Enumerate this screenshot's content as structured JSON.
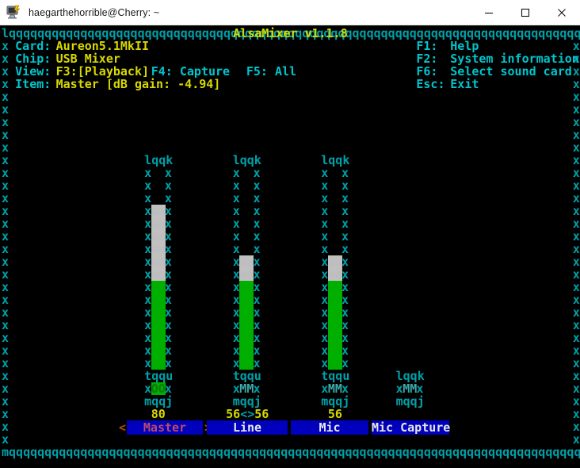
{
  "window": {
    "title": "haegarthehorrible@Cherry: ~",
    "icon": "putty-terminal-icon",
    "minimize_label": "–",
    "maximize_label": "□",
    "close_label": "✕"
  },
  "app": {
    "name": "AlsaMixer",
    "version": "v1.1.8",
    "header_title": "AlsaMixer v1.1.8"
  },
  "info": {
    "card_label": "Card:",
    "card_value": "Aureon5.1MkII",
    "chip_label": "Chip:",
    "chip_value": "USB Mixer",
    "view_label": "View:",
    "view_value": "F3:[Playback] F4: Capture  F5: All",
    "view_playback": "F3:[Playback]",
    "view_capture": "F4: Capture",
    "view_all": "F5: All",
    "item_label": "Item:",
    "item_value": "Master [dB gain: -4.94]"
  },
  "help": [
    {
      "key": "F1:",
      "text": "Help"
    },
    {
      "key": "F2:",
      "text": "System information"
    },
    {
      "key": "F6:",
      "text": "Select sound card"
    },
    {
      "key": "Esc:",
      "text": "Exit"
    }
  ],
  "frame": {
    "top_left": "l",
    "top_right": "k",
    "bottom_left": "m",
    "bottom_right": "j",
    "horizontal": "q",
    "vertical": "x",
    "tee_up": "t",
    "tee_down_right": "u"
  },
  "bar_glyphs": {
    "top": "lqqk",
    "side": "x",
    "fill": "aa",
    "empty": "  ",
    "mid_sep": "tqqu",
    "bottom": "mqqj",
    "mute_on": "OO",
    "mute_off": "MM"
  },
  "channels": [
    {
      "name": "Master",
      "selected": true,
      "value_text": "80",
      "bar_rows": 16,
      "empty_rows": 3,
      "grey_rows": 6,
      "green_rows": 7,
      "mute_glyph": "OO",
      "muted": false,
      "has_bar": true,
      "left_arrow": "<",
      "right_arrow": ">"
    },
    {
      "name": "Line",
      "selected": false,
      "value_text": "56<>56",
      "bar_rows": 16,
      "empty_rows": 7,
      "grey_rows": 2,
      "green_rows": 7,
      "mute_glyph": "MM",
      "muted": true,
      "has_bar": true
    },
    {
      "name": "Mic",
      "selected": false,
      "value_text": "56",
      "bar_rows": 16,
      "empty_rows": 7,
      "grey_rows": 2,
      "green_rows": 7,
      "mute_glyph": "MM",
      "muted": true,
      "has_bar": true
    },
    {
      "name": "Mic Capture",
      "selected": false,
      "value_text": "",
      "bar_rows": 0,
      "empty_rows": 0,
      "grey_rows": 0,
      "green_rows": 0,
      "mute_glyph": "MM",
      "muted": true,
      "has_bar": false
    }
  ],
  "colors": {
    "frame": "#00a0a8",
    "label": "#00c5cd",
    "value": "#d8d800",
    "bar_grey": "#c0c0c0",
    "bar_green": "#00b000",
    "tab_bg": "#0000bd",
    "tab_selected_fg": "#c04a6a",
    "tab_fg": "#e8e8e8",
    "arrow": "#b05000",
    "background": "#000000",
    "titlebar_bg": "#ffffff"
  }
}
